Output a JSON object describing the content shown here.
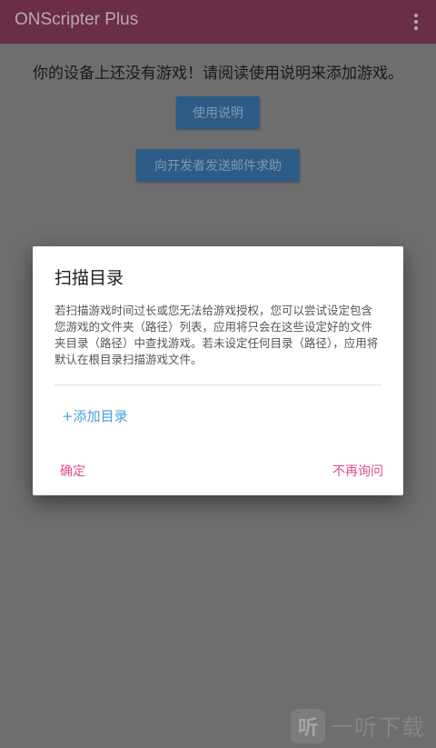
{
  "appbar": {
    "title": "ONScripter Plus"
  },
  "main": {
    "message": "你的设备上还没有游戏！请阅读使用说明来添加游戏。",
    "help_button": "使用说明",
    "email_button": "向开发者发送邮件求助"
  },
  "dialog": {
    "title": "扫描目录",
    "body": "若扫描游戏时间过长或您无法给游戏授权，您可以尝试设定包含您游戏的文件夹（路径）列表，应用将只会在这些设定好的文件夹目录（路径）中查找游戏。若未设定任何目录（路径），应用将默认在根目录扫描游戏文件。",
    "add_directory": "+添加目录",
    "confirm_button": "确定",
    "never_ask_button": "不再询问"
  },
  "watermark": {
    "icon_text": "听",
    "text": "一听下载"
  },
  "colors": {
    "appbar": "#6b2e46",
    "dialog_action": "#e04d88",
    "link": "#44a3d6",
    "button": "#2d5c86"
  }
}
